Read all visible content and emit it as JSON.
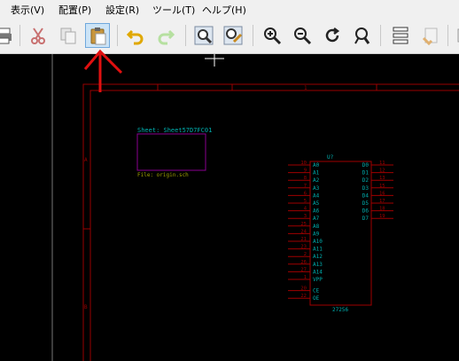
{
  "menubar": {
    "items": [
      {
        "label": "表示(V)"
      },
      {
        "label": "配置(P)"
      },
      {
        "label": "設定(R)"
      },
      {
        "label": "ツール(T)"
      },
      {
        "label": "ヘルプ(H)"
      }
    ]
  },
  "toolbar": {
    "buttons": [
      {
        "name": "print-button",
        "icon": "printer-icon"
      },
      {
        "name": "cut-button",
        "icon": "scissors-icon"
      },
      {
        "name": "copy-button",
        "icon": "copy-icon"
      },
      {
        "name": "paste-button",
        "icon": "clipboard-icon",
        "active": true
      },
      {
        "name": "undo-button",
        "icon": "undo-icon"
      },
      {
        "name": "redo-button",
        "icon": "redo-icon"
      },
      {
        "name": "find-button",
        "icon": "find-icon"
      },
      {
        "name": "find-replace-button",
        "icon": "find-replace-icon"
      },
      {
        "name": "zoom-in-button",
        "icon": "zoom-in-icon"
      },
      {
        "name": "zoom-out-button",
        "icon": "zoom-out-icon"
      },
      {
        "name": "redraw-button",
        "icon": "redraw-icon"
      },
      {
        "name": "zoom-fit-button",
        "icon": "zoom-fit-icon"
      },
      {
        "name": "hierarchy-button",
        "icon": "hierarchy-icon"
      },
      {
        "name": "leave-sheet-button",
        "icon": "leave-sheet-icon"
      }
    ]
  },
  "schematic": {
    "sheet_name": "Sheet: Sheet57D7FC01",
    "sheet_file": "File: origin.sch",
    "ref_top": "1",
    "ref_left_a": "A",
    "ref_left_b": "B",
    "component": {
      "ref": "U?",
      "value": "27256",
      "left_pins": [
        {
          "num": "10",
          "name": "A0"
        },
        {
          "num": "9",
          "name": "A1"
        },
        {
          "num": "8",
          "name": "A2"
        },
        {
          "num": "7",
          "name": "A3"
        },
        {
          "num": "6",
          "name": "A4"
        },
        {
          "num": "5",
          "name": "A5"
        },
        {
          "num": "4",
          "name": "A6"
        },
        {
          "num": "3",
          "name": "A7"
        },
        {
          "num": "25",
          "name": "A8"
        },
        {
          "num": "24",
          "name": "A9"
        },
        {
          "num": "21",
          "name": "A10"
        },
        {
          "num": "23",
          "name": "A11"
        },
        {
          "num": "2",
          "name": "A12"
        },
        {
          "num": "26",
          "name": "A13"
        },
        {
          "num": "27",
          "name": "A14"
        },
        {
          "num": "1",
          "name": "VPP"
        },
        {
          "num": "20",
          "name": "CE"
        },
        {
          "num": "22",
          "name": "OE"
        }
      ],
      "right_pins": [
        {
          "num": "11",
          "name": "D0"
        },
        {
          "num": "12",
          "name": "D1"
        },
        {
          "num": "13",
          "name": "D2"
        },
        {
          "num": "15",
          "name": "D3"
        },
        {
          "num": "16",
          "name": "D4"
        },
        {
          "num": "17",
          "name": "D5"
        },
        {
          "num": "18",
          "name": "D6"
        },
        {
          "num": "19",
          "name": "D7"
        }
      ]
    }
  },
  "colors": {
    "border": "#9a0000",
    "sheet_box": "#8a0090",
    "cyan": "#00b0b0",
    "pin": "#a00000",
    "component_outline": "#a00000",
    "file_text": "#a0a000"
  }
}
